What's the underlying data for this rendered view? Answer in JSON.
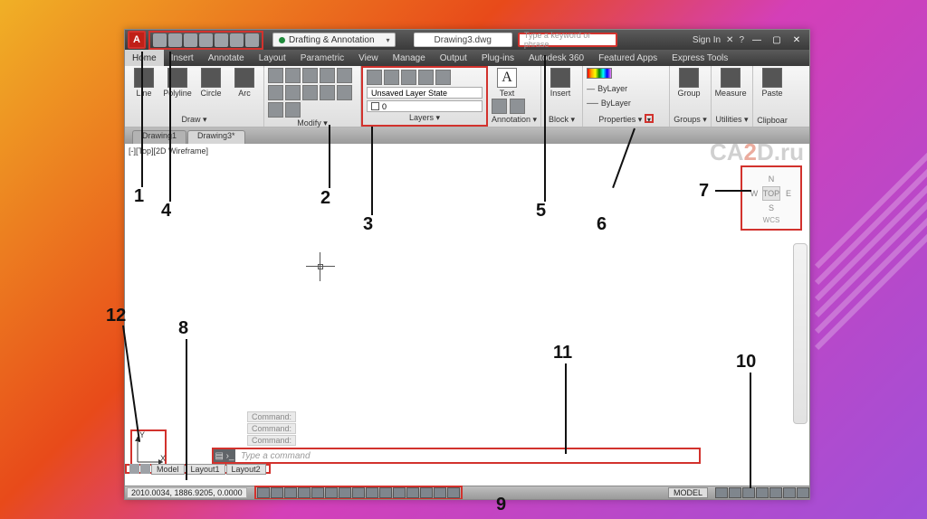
{
  "title": {
    "doc": "Drawing3.dwg",
    "workspace": "Drafting & Annotation"
  },
  "search": {
    "placeholder": "Type a keyword or phrase"
  },
  "signin": {
    "label": "Sign In"
  },
  "tabs": [
    "Home",
    "Insert",
    "Annotate",
    "Layout",
    "Parametric",
    "View",
    "Manage",
    "Output",
    "Plug-ins",
    "Autodesk 360",
    "Featured Apps",
    "Express Tools"
  ],
  "ribbon": {
    "draw": {
      "title": "Draw ▾",
      "tools": [
        "Line",
        "Polyline",
        "Circle",
        "Arc"
      ]
    },
    "modify": {
      "title": "Modify ▾"
    },
    "layers": {
      "title": "Layers ▾",
      "state": "Unsaved Layer State",
      "current": "0"
    },
    "annotation": {
      "title": "Annotation ▾",
      "text": "Text"
    },
    "block": {
      "title": "Block ▾",
      "insert": "Insert"
    },
    "properties": {
      "title": "Properties ▾",
      "bylayer": "ByLayer"
    },
    "groups": {
      "title": "Groups ▾",
      "group": "Group"
    },
    "utilities": {
      "title": "Utilities ▾",
      "measure": "Measure"
    },
    "clipboard": {
      "title": "Clipboar",
      "paste": "Paste"
    }
  },
  "filetabs": {
    "a": "Drawing1",
    "b": "Drawing3*"
  },
  "viewctl": "[-][Top][2D Wireframe]",
  "viewcube": {
    "n": "N",
    "s": "S",
    "e": "E",
    "w": "W",
    "top": "TOP",
    "wcs": "WCS"
  },
  "ucs": {
    "x": "X",
    "y": "Y"
  },
  "cmd": {
    "history": [
      "Command:",
      "Command:",
      "Command:"
    ],
    "placeholder": "Type a command"
  },
  "layouttabs": {
    "model": "Model",
    "l1": "Layout1",
    "l2": "Layout2"
  },
  "status": {
    "coords": "2010.0034, 1886.9205, 0.0000",
    "model": "MODEL"
  },
  "watermark": {
    "a": "CA",
    "b": "2",
    "c": "D.ru"
  },
  "annotations": {
    "n1": "1",
    "n2": "2",
    "n3": "3",
    "n4": "4",
    "n5": "5",
    "n6": "6",
    "n7": "7",
    "n8": "8",
    "n9": "9",
    "n10": "10",
    "n11": "11",
    "n12": "12"
  }
}
